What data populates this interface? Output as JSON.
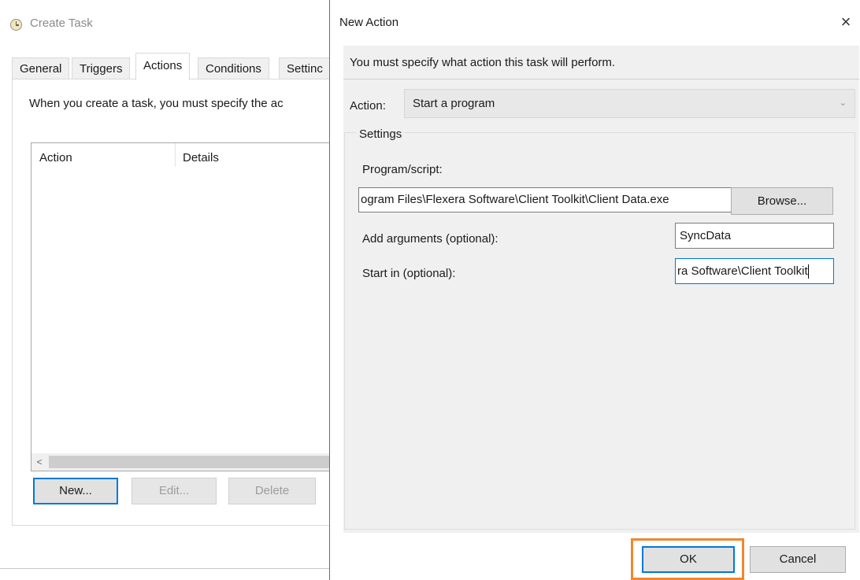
{
  "create_task": {
    "title": "Create Task",
    "tabs": [
      "General",
      "Triggers",
      "Actions",
      "Conditions",
      "Settinc"
    ],
    "intro_text": "When you create a task, you must specify the ac",
    "columns": {
      "action": "Action",
      "details": "Details"
    },
    "scroll_left_glyph": "<",
    "buttons": {
      "new": "New...",
      "edit": "Edit...",
      "delete": "Delete"
    }
  },
  "new_action": {
    "title": "New Action",
    "close_glyph": "×",
    "heading": "You must specify what action this task will perform.",
    "action_label": "Action:",
    "action_value": "Start a program",
    "chevron_glyph": "⌄",
    "settings_label": "Settings",
    "program_label": "Program/script:",
    "program_value": "ogram Files\\Flexera Software\\Client Toolkit\\Client Data.exe",
    "browse_label": "Browse...",
    "args_label": "Add arguments (optional):",
    "args_value": "SyncData",
    "start_label": "Start in (optional):",
    "start_value": "ra Software\\Client Toolkit",
    "ok_label": "OK",
    "cancel_label": "Cancel"
  },
  "colors": {
    "focus_blue": "#0078d7",
    "highlight_orange": "#f0872f",
    "dialog_body": "#f0f0f0"
  }
}
